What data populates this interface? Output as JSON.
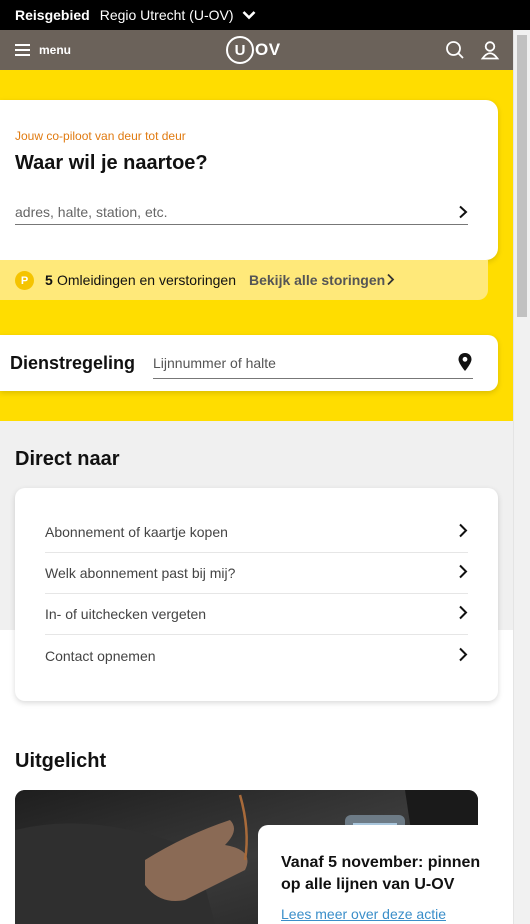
{
  "region": {
    "label": "Reisgebied",
    "value": "Regio Utrecht (U-OV)"
  },
  "header": {
    "menu_label": "menu",
    "logo_letter": "U",
    "logo_text": "OV"
  },
  "planner": {
    "tagline": "Jouw co-piloot van deur tot deur",
    "title": "Waar wil je naartoe?",
    "placeholder": "adres, halte, station, etc."
  },
  "disruptions": {
    "badge": "P",
    "count": "5",
    "text": "Omleidingen en verstoringen",
    "link": "Bekijk alle storingen"
  },
  "schedule": {
    "label": "Dienstregeling",
    "placeholder": "Lijnnummer of halte"
  },
  "direct": {
    "title": "Direct naar",
    "items": [
      {
        "label": "Abonnement of kaartje kopen"
      },
      {
        "label": "Welk abonnement past bij mij?"
      },
      {
        "label": "In- of uitchecken vergeten"
      },
      {
        "label": "Contact opnemen"
      }
    ]
  },
  "featured": {
    "title": "Uitgelicht",
    "card_title": "Vanaf 5 november: pinnen op alle lijnen van U-OV",
    "card_link": "Lees meer over deze actie"
  },
  "colors": {
    "brand_yellow": "#ffdd00",
    "header": "#6b625a",
    "accent_orange": "#e07a10",
    "link_blue": "#3a8ec9"
  }
}
